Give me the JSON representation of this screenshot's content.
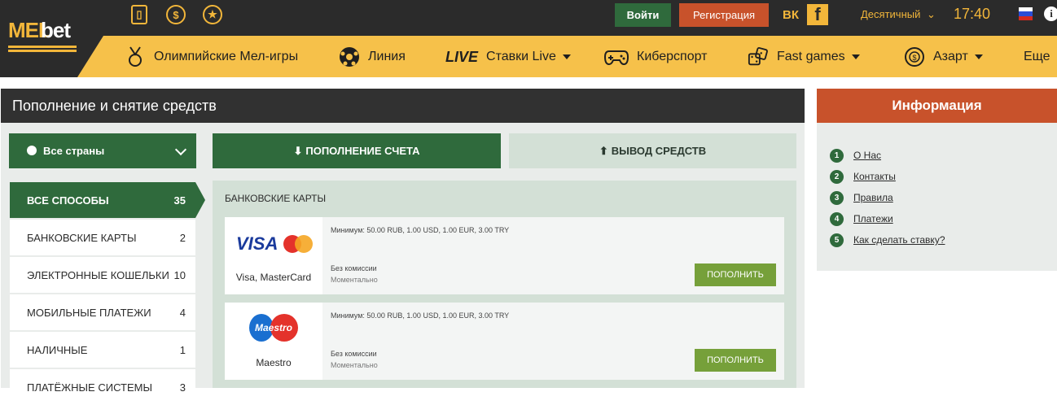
{
  "header": {
    "logo": "MELbet",
    "top_icons": [
      "mobile-app-icon",
      "dollar-icon",
      "star-bonus-icon"
    ],
    "login_label": "Войти",
    "register_label": "Регистрация",
    "social": [
      "ВК",
      "f"
    ],
    "odds_format": "Десятичный",
    "time": "17:40",
    "info_glyph": "i"
  },
  "nav": {
    "olympic": "Олимпийские Мел-игры",
    "line": "Линия",
    "live_badge": "LIVE",
    "live": "Ставки Live",
    "esports": "Киберспорт",
    "fast_games": "Fast games",
    "casino": "Азарт",
    "more": "Еще"
  },
  "main": {
    "title": "Пополнение и снятие средств",
    "country_select": "Все страны",
    "tab_deposit": "ПОПОЛНЕНИЕ СЧЕТА",
    "tab_withdraw": "ВЫВОД СРЕДСТВ",
    "methods": [
      {
        "label": "ВСЕ СПОСОБЫ",
        "count": "35"
      },
      {
        "label": "БАНКОВСКИЕ КАРТЫ",
        "count": "2"
      },
      {
        "label": "ЭЛЕКТРОННЫЕ КОШЕЛЬКИ",
        "count": "10"
      },
      {
        "label": "МОБИЛЬНЫЕ ПЛАТЕЖИ",
        "count": "4"
      },
      {
        "label": "НАЛИЧНЫЕ",
        "count": "1"
      },
      {
        "label": "ПЛАТЁЖНЫЕ СИСТЕМЫ",
        "count": "3"
      }
    ],
    "section_title": "БАНКОВСКИЕ КАРТЫ",
    "cards": [
      {
        "name": "Visa, MasterCard",
        "logo_text": "VISA",
        "minimum": "Минимум: 50.00 RUB, 1.00 USD, 1.00 EUR, 3.00 TRY",
        "fee": "Без комиссии",
        "speed": "Моментально",
        "button": "ПОПОЛНИТЬ"
      },
      {
        "name": "Maestro",
        "logo_text": "Maestro",
        "minimum": "Минимум: 50.00 RUB, 1.00 USD, 1.00 EUR, 3.00 TRY",
        "fee": "Без комиссии",
        "speed": "Моментально",
        "button": "ПОПОЛНИТЬ"
      }
    ]
  },
  "info": {
    "title": "Информация",
    "items": [
      {
        "num": "1",
        "label": "О Нас"
      },
      {
        "num": "2",
        "label": "Контакты"
      },
      {
        "num": "3",
        "label": "Правила"
      },
      {
        "num": "4",
        "label": "Платежи"
      },
      {
        "num": "5",
        "label": "Как сделать ставку?"
      }
    ]
  },
  "colors": {
    "brand_green": "#2f6a3c",
    "accent_yellow": "#f6c14a",
    "accent_orange": "#c8522b",
    "pay_button": "#76a03a"
  }
}
